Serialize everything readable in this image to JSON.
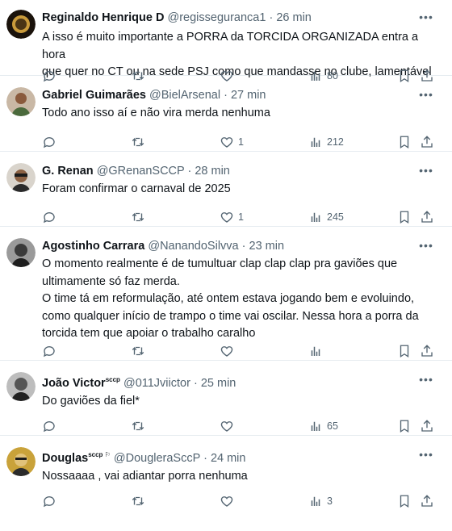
{
  "tweets": [
    {
      "name": "Reginaldo Henrique D",
      "name_sup": "",
      "handle": "@regisseguranca1",
      "sep": "·",
      "time": "26 min",
      "body": [
        "A isso é muito importante a PORRA da TORCIDA ORGANIZADA entra a hora",
        "que quer no CT ou na sede PSJ como que mandasse no clube, lamentável"
      ],
      "replies": "",
      "retweets": "",
      "likes": "",
      "views": "80"
    },
    {
      "name": "Gabriel Guimarães",
      "name_sup": "",
      "handle": "@BielArsenal",
      "sep": "·",
      "time": "27 min",
      "body": [
        "Todo ano isso aí e não vira merda nenhuma"
      ],
      "replies": "",
      "retweets": "",
      "likes": "1",
      "views": "212"
    },
    {
      "name": "G. Renan",
      "name_sup": "",
      "handle": "@GRenanSCCP",
      "sep": "·",
      "time": "28 min",
      "body": [
        "Foram confirmar o carnaval de 2025"
      ],
      "replies": "",
      "retweets": "",
      "likes": "1",
      "views": "245"
    },
    {
      "name": "Agostinho Carrara",
      "name_sup": "",
      "handle": "@NanandoSilvva",
      "sep": "·",
      "time": "23 min",
      "body": [
        "O momento realmente é de tumultuar clap clap clap pra gaviões que",
        "ultimamente só faz merda.",
        "O time tá em reformulação, até ontem estava jogando bem e evoluindo,",
        "como qualquer início de trampo o time vai oscilar. Nessa hora a porra da",
        "torcida tem que apoiar o trabalho caralho"
      ],
      "replies": "",
      "retweets": "",
      "likes": "",
      "views": ""
    },
    {
      "name": "João Victor",
      "name_sup": "sccp",
      "handle": "@011Jviictor",
      "sep": "·",
      "time": "25 min",
      "body": [
        "Do gaviões da fiel*"
      ],
      "replies": "",
      "retweets": "",
      "likes": "",
      "views": "65"
    },
    {
      "name": "Douglas",
      "name_sup": "sccp ⚐",
      "handle": "@DougleraSccP",
      "sep": "·",
      "time": "24 min",
      "body": [
        "Nossaaaa , vai adiantar porra nenhuma"
      ],
      "replies": "",
      "retweets": "",
      "likes": "",
      "views": "3"
    }
  ],
  "icons": {
    "reply": "reply-icon",
    "retweet": "retweet-icon",
    "like": "heart-icon",
    "views": "views-icon",
    "bookmark": "bookmark-icon",
    "share": "share-icon",
    "more": "more-icon"
  },
  "colors": {
    "muted": "#536471",
    "text": "#0f1419",
    "divider": "#e6ecf0"
  }
}
